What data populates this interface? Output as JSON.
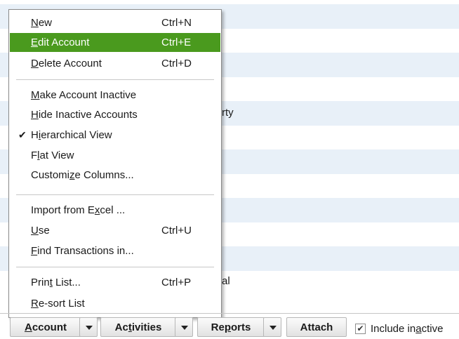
{
  "background_list": {
    "visible_fragments": [
      "rty",
      "al"
    ]
  },
  "account_menu": {
    "items": [
      {
        "pre": "",
        "u": "N",
        "post": "ew",
        "shortcut": "Ctrl+N"
      },
      {
        "pre": "",
        "u": "E",
        "post": "dit Account",
        "shortcut": "Ctrl+E",
        "highlighted": true
      },
      {
        "pre": "",
        "u": "D",
        "post": "elete Account",
        "shortcut": "Ctrl+D"
      },
      {
        "pre": "",
        "u": "M",
        "post": "ake Account Inactive",
        "shortcut": ""
      },
      {
        "pre": "",
        "u": "H",
        "post": "ide Inactive Accounts",
        "shortcut": ""
      },
      {
        "pre": "H",
        "u": "i",
        "post": "erarchical View",
        "shortcut": "",
        "checked": true,
        "check_glyph": "✔"
      },
      {
        "pre": "F",
        "u": "l",
        "post": "at View",
        "shortcut": ""
      },
      {
        "pre": "Customi",
        "u": "z",
        "post": "e Columns...",
        "shortcut": ""
      },
      {
        "pre": "Import from E",
        "u": "x",
        "post": "cel ...",
        "shortcut": ""
      },
      {
        "pre": "",
        "u": "U",
        "post": "se",
        "shortcut": "Ctrl+U"
      },
      {
        "pre": "",
        "u": "F",
        "post": "ind Transactions in...",
        "shortcut": ""
      },
      {
        "pre": "Prin",
        "u": "t",
        "post": " List...",
        "shortcut": "Ctrl+P"
      },
      {
        "pre": "",
        "u": "R",
        "post": "e-sort List",
        "shortcut": ""
      }
    ]
  },
  "toolbar": {
    "account": {
      "u": "A",
      "post": "ccount"
    },
    "activities": {
      "pre": "Ac",
      "u": "t",
      "post": "ivities"
    },
    "reports": {
      "pre": "Re",
      "u": "p",
      "post": "orts"
    },
    "attach": "Attach",
    "include_inactive": {
      "pre": "Include in",
      "u": "a",
      "post": "ctive",
      "checked": true,
      "check_glyph": "✔"
    }
  }
}
